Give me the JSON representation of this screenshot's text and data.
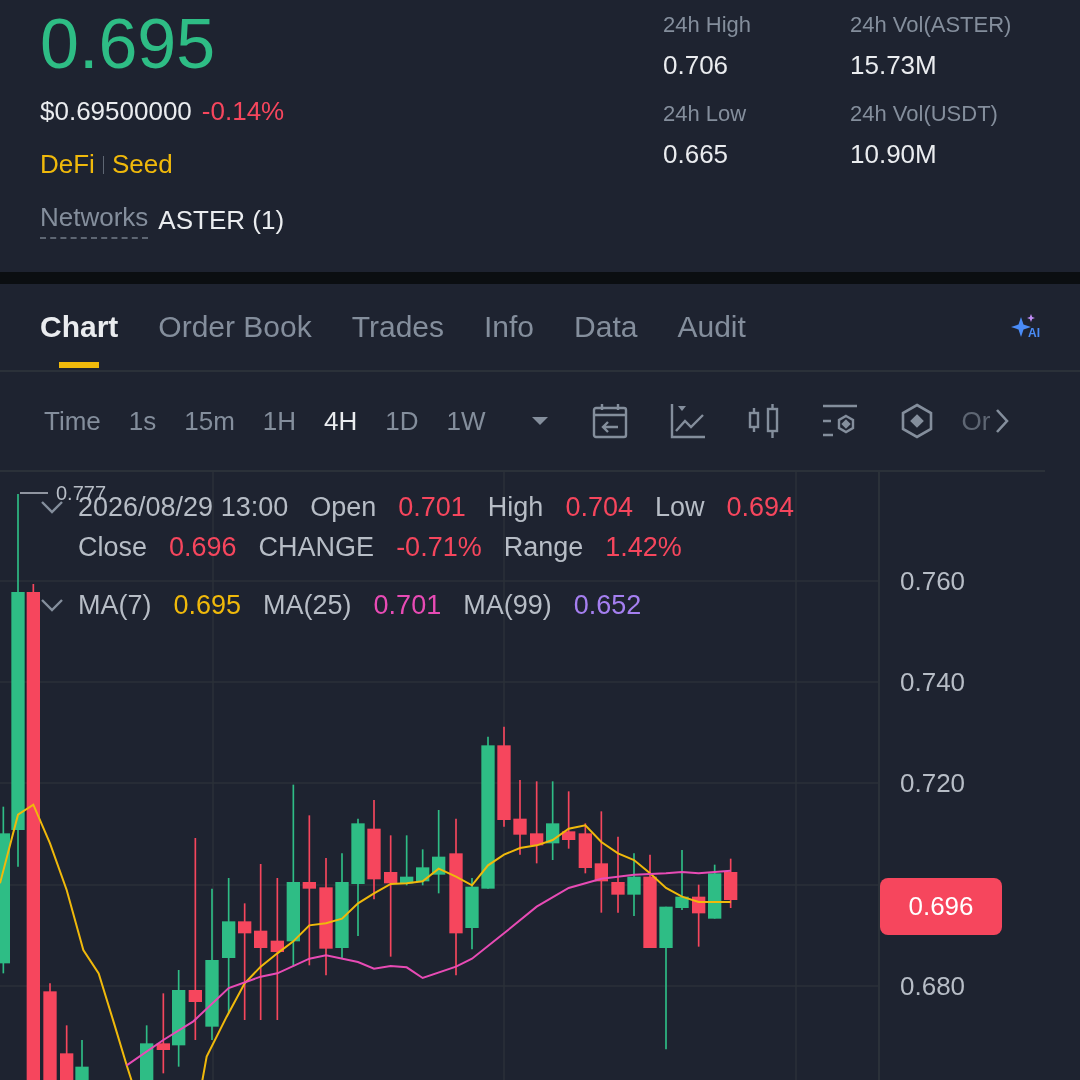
{
  "ticker": {
    "price": "0.695",
    "fiat_price": "$0.69500000",
    "change": "-0.14%",
    "tags": [
      "DeFi",
      "Seed"
    ],
    "networks_label": "Networks",
    "networks_value": "ASTER (1)"
  },
  "stats": [
    {
      "label": "24h High",
      "value": "0.706"
    },
    {
      "label": "24h Vol(ASTER)",
      "value": "15.73M"
    },
    {
      "label": "24h Low",
      "value": "0.665"
    },
    {
      "label": "24h Vol(USDT)",
      "value": "10.90M"
    }
  ],
  "tabs": [
    {
      "label": "Chart",
      "selected": true
    },
    {
      "label": "Order Book",
      "selected": false
    },
    {
      "label": "Trades",
      "selected": false
    },
    {
      "label": "Info",
      "selected": false
    },
    {
      "label": "Data",
      "selected": false
    },
    {
      "label": "Audit",
      "selected": false
    }
  ],
  "ai_button": "AI",
  "intervals": [
    {
      "label": "Time",
      "selected": false
    },
    {
      "label": "1s",
      "selected": false
    },
    {
      "label": "15m",
      "selected": false
    },
    {
      "label": "1H",
      "selected": false
    },
    {
      "label": "4H",
      "selected": true
    },
    {
      "label": "1D",
      "selected": false
    },
    {
      "label": "1W",
      "selected": false
    }
  ],
  "toolbar_more": "Or",
  "chart": {
    "max_label": "0.777",
    "timestamp": "2026/08/29 13:00",
    "ohlc": [
      {
        "label": "Open",
        "value": "0.701"
      },
      {
        "label": "High",
        "value": "0.704"
      },
      {
        "label": "Low",
        "value": "0.694"
      },
      {
        "label": "Close",
        "value": "0.696"
      },
      {
        "label": "CHANGE",
        "value": "-0.71%"
      },
      {
        "label": "Range",
        "value": "1.42%"
      }
    ],
    "moving_averages": [
      {
        "label": "MA(7)",
        "value": "0.695",
        "color": "#f0b90b"
      },
      {
        "label": "MA(25)",
        "value": "0.701",
        "color": "#e84bb5"
      },
      {
        "label": "MA(99)",
        "value": "0.652",
        "color": "#a57ff0"
      }
    ],
    "y_axis": [
      "0.760",
      "0.740",
      "0.720",
      "0.680"
    ],
    "current_price": "0.696"
  }
}
